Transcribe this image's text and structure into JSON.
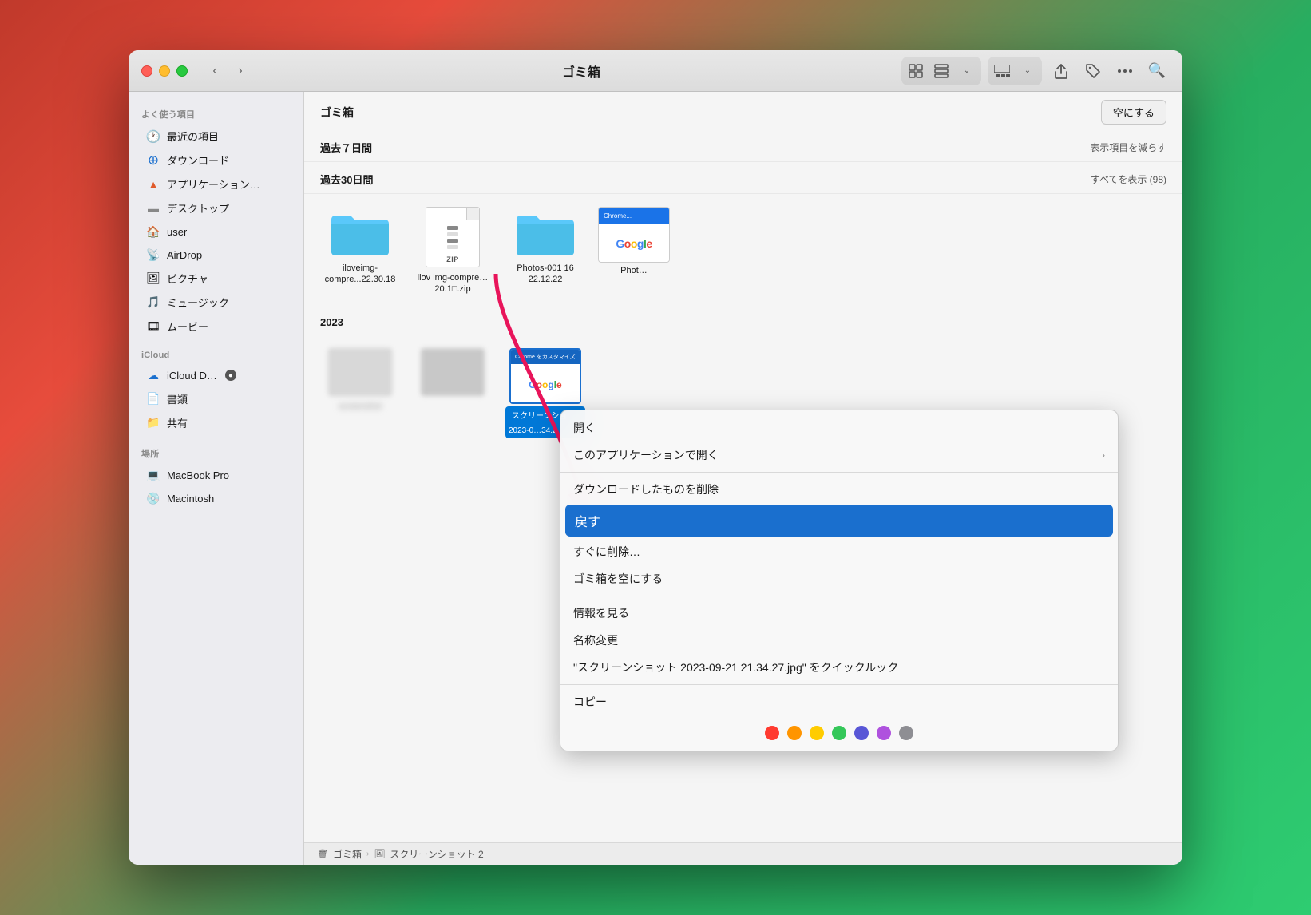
{
  "window": {
    "title": "ゴミ箱"
  },
  "toolbar": {
    "back_label": "‹",
    "forward_label": "›",
    "view_grid_label": "⊞",
    "view_list_label": "⊟",
    "share_label": "↑",
    "tag_label": "◇",
    "more_label": "···",
    "search_label": "⌕"
  },
  "sidebar": {
    "favorites_label": "よく使う項目",
    "icloud_label": "iCloud",
    "location_label": "場所",
    "items": [
      {
        "id": "recents",
        "icon": "🕐",
        "label": "最近の項目"
      },
      {
        "id": "downloads",
        "icon": "⊕",
        "label": "ダウンロード"
      },
      {
        "id": "applications",
        "icon": "🔺",
        "label": "アプリケーション…"
      },
      {
        "id": "desktop",
        "icon": "▭",
        "label": "デスクトップ"
      },
      {
        "id": "user",
        "icon": "🏠",
        "label": "user"
      },
      {
        "id": "airdrop",
        "icon": "📡",
        "label": "AirDrop"
      },
      {
        "id": "pictures",
        "icon": "🖼",
        "label": "ピクチャ"
      },
      {
        "id": "music",
        "icon": "🎵",
        "label": "ミュージック"
      },
      {
        "id": "movies",
        "icon": "🎞",
        "label": "ムービー"
      },
      {
        "id": "icloud-drive",
        "icon": "☁",
        "label": "iCloud D…",
        "badge": "●"
      },
      {
        "id": "documents",
        "icon": "📄",
        "label": "書類"
      },
      {
        "id": "shared",
        "icon": "📁",
        "label": "共有"
      },
      {
        "id": "macbook",
        "icon": "💻",
        "label": "MacBook Pro"
      },
      {
        "id": "macintosh",
        "icon": "💿",
        "label": "Macintosh"
      }
    ]
  },
  "content": {
    "header_title": "ゴミ箱",
    "empty_trash_btn": "空にする",
    "section_past7": {
      "title": "過去７日間",
      "action": "表示項目を減らす"
    },
    "section_past30": {
      "title": "過去30日間",
      "action": "すべてを表示 (98)"
    },
    "section_2023": {
      "title": "2023"
    },
    "files_30": [
      {
        "name": "iloveimg-compre...22.30.18",
        "type": "folder"
      },
      {
        "name": "ilov img-compre…20.1□.zip",
        "type": "zip"
      },
      {
        "name": "Photos-001 16 22.12.22",
        "type": "folder"
      },
      {
        "name": "Phot…",
        "type": "screenshot"
      }
    ]
  },
  "breadcrumb": {
    "trash": "ゴミ箱",
    "file": "スクリーンショット 2"
  },
  "context_menu": {
    "items": [
      {
        "id": "open",
        "label": "開く",
        "highlighted": false,
        "has_arrow": false
      },
      {
        "id": "open-with",
        "label": "このアプリケーションで開く",
        "highlighted": false,
        "has_arrow": true
      },
      {
        "id": "separator1",
        "type": "separator"
      },
      {
        "id": "delete-downloaded",
        "label": "ダウンロードしたものを削除",
        "highlighted": false,
        "has_arrow": false
      },
      {
        "id": "put-back",
        "label": "戻す",
        "highlighted": true,
        "has_arrow": false
      },
      {
        "id": "delete-immediately",
        "label": "すぐに削除…",
        "highlighted": false,
        "has_arrow": false
      },
      {
        "id": "empty-trash",
        "label": "ゴミ箱を空にする",
        "highlighted": false,
        "has_arrow": false
      },
      {
        "id": "separator2",
        "type": "separator"
      },
      {
        "id": "get-info",
        "label": "情報を見る",
        "highlighted": false,
        "has_arrow": false
      },
      {
        "id": "rename",
        "label": "名称変更",
        "highlighted": false,
        "has_arrow": false
      },
      {
        "id": "quicklook",
        "label": "\"スクリーンショット 2023-09-21 21.34.27.jpg\" をクイックルック",
        "highlighted": false,
        "has_arrow": false
      },
      {
        "id": "separator3",
        "type": "separator"
      },
      {
        "id": "copy",
        "label": "コピー",
        "highlighted": false,
        "has_arrow": false
      }
    ],
    "color_dots": [
      {
        "color": "#ff3b30",
        "label": "red"
      },
      {
        "color": "#ff9500",
        "label": "orange"
      },
      {
        "color": "#ffcc00",
        "label": "yellow"
      },
      {
        "color": "#34c759",
        "label": "green"
      },
      {
        "color": "#5856d6",
        "label": "blue"
      },
      {
        "color": "#af52de",
        "label": "purple"
      },
      {
        "color": "#8e8e93",
        "label": "gray"
      }
    ]
  }
}
